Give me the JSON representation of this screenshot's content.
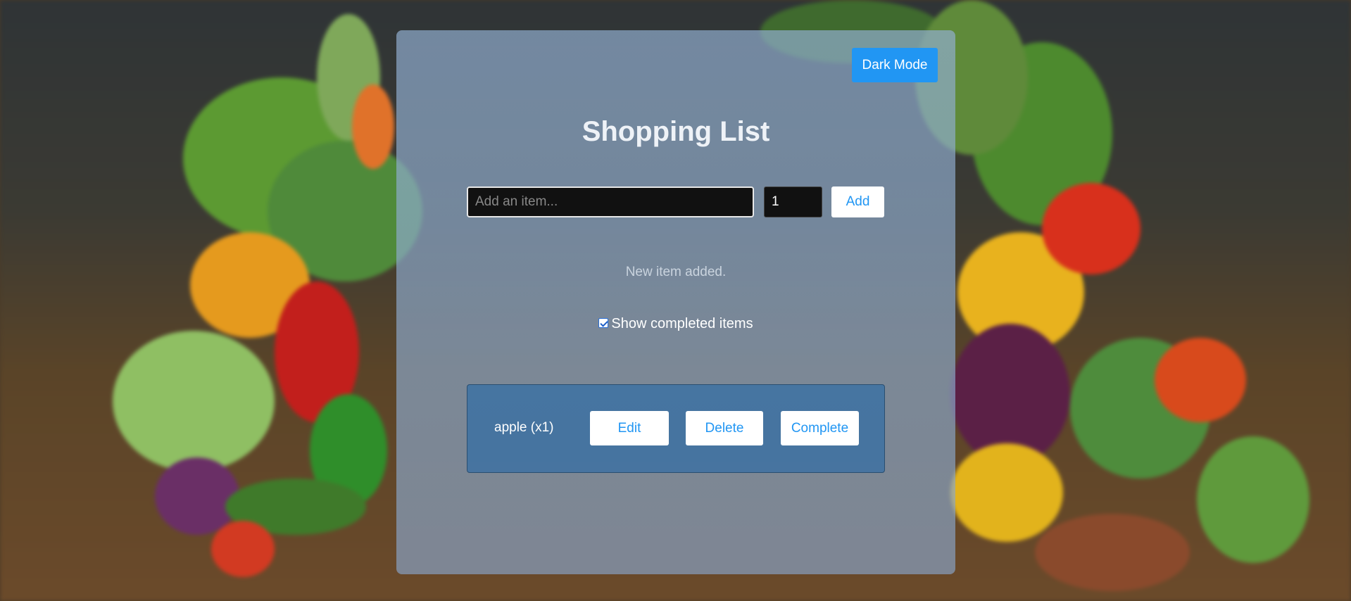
{
  "header": {
    "dark_mode_label": "Dark Mode",
    "title": "Shopping List"
  },
  "form": {
    "item_placeholder": "Add an item...",
    "item_value": "",
    "quantity_value": "1",
    "add_label": "Add"
  },
  "status_message": "New item added.",
  "filter": {
    "show_completed_label": "Show completed items",
    "show_completed_checked": true
  },
  "list": {
    "items": [
      {
        "text": "apple (x1)",
        "edit_label": "Edit",
        "delete_label": "Delete",
        "complete_label": "Complete"
      }
    ]
  },
  "colors": {
    "accent": "#2196f3",
    "panel": "#8caacd"
  },
  "background": {
    "description_icon": "vegetable-background-image"
  }
}
